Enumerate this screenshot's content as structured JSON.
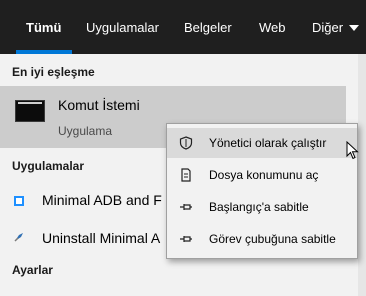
{
  "tabs": [
    {
      "label": "Tümü",
      "active": true
    },
    {
      "label": "Uygulamalar"
    },
    {
      "label": "Belgeler"
    },
    {
      "label": "Web"
    },
    {
      "label": "Diğer"
    }
  ],
  "sections": {
    "best_match": "En iyi eşleşme",
    "apps": "Uygulamalar",
    "settings": "Ayarlar"
  },
  "best_match_item": {
    "title": "Komut İstemi",
    "subtitle": "Uygulama",
    "icon": "command-prompt-icon"
  },
  "apps": [
    {
      "label": "Minimal ADB and F",
      "icon": "adb-app-icon"
    },
    {
      "label": "Uninstall Minimal A",
      "icon": "uninstall-app-icon"
    }
  ],
  "context_menu": {
    "items": [
      {
        "label": "Yönetici olarak çalıştır",
        "icon": "shield-icon"
      },
      {
        "label": "Dosya konumunu aç",
        "icon": "file-location-icon"
      },
      {
        "label": "Başlangıç'a sabitle",
        "icon": "pin-icon"
      },
      {
        "label": "Görev çubuğuna sabitle",
        "icon": "pin-icon"
      }
    ]
  },
  "colors": {
    "tabbar_bg": "#1f1f1f",
    "accent": "#0078d7",
    "selected_row": "#cccccc",
    "panel_bg": "#f2f2f2"
  }
}
